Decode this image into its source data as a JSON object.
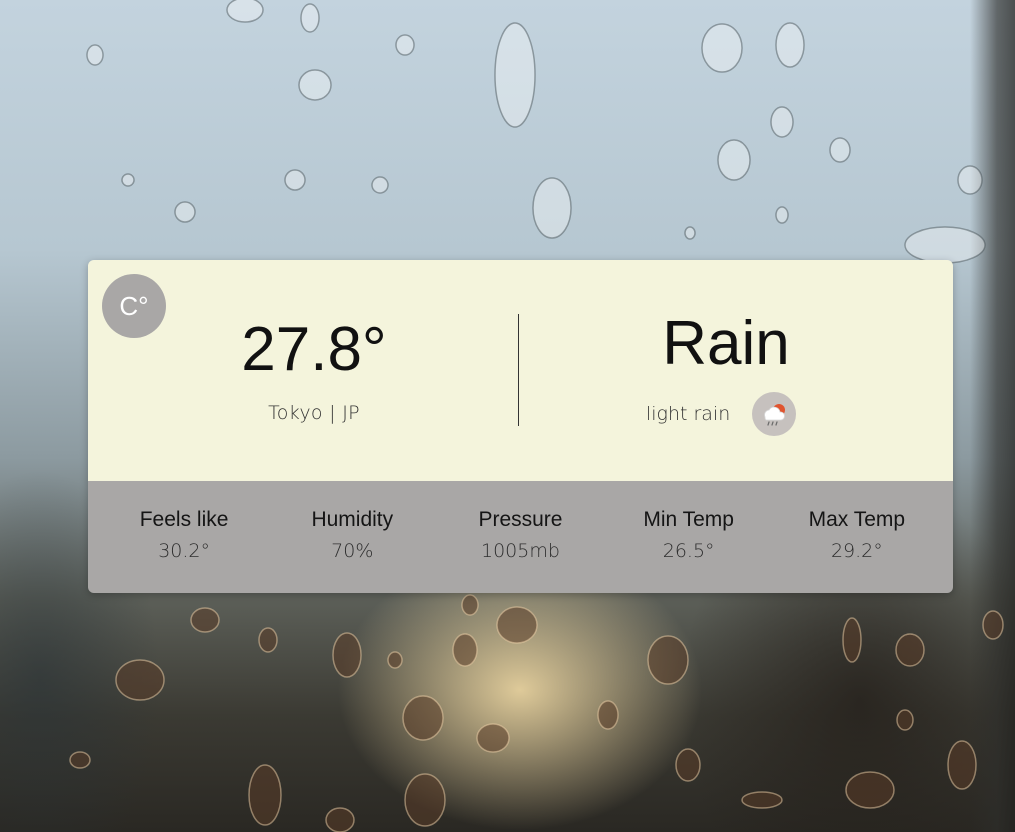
{
  "unit_toggle": {
    "label": "C°"
  },
  "current": {
    "temperature": "27.8°",
    "location": "Tokyo | JP",
    "condition": "Rain",
    "description": "light rain",
    "icon": "rain-cloud-sun-icon"
  },
  "details": [
    {
      "label": "Feels like",
      "value": "30.2°"
    },
    {
      "label": "Humidity",
      "value": "70%"
    },
    {
      "label": "Pressure",
      "value": "1005mb"
    },
    {
      "label": "Min Temp",
      "value": "26.5°"
    },
    {
      "label": "Max Temp",
      "value": "29.2°"
    }
  ],
  "colors": {
    "card_top": "#f4f4dc",
    "card_bottom": "#a9a7a6",
    "toggle_bg": "#a9a7a6",
    "icon_bg": "#c6c1be"
  }
}
